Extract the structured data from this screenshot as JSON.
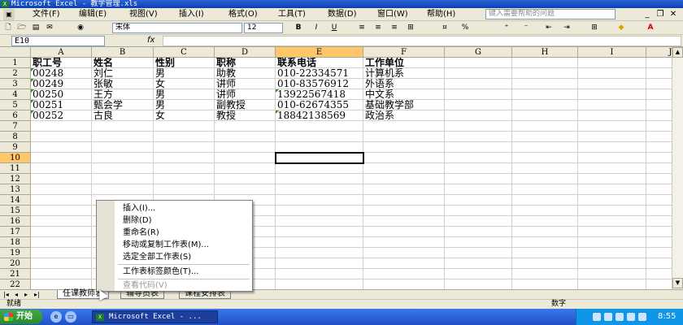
{
  "window": {
    "title": "Microsoft Excel - 教学管理.xls",
    "icon": "excel-icon"
  },
  "menu": {
    "items": [
      "文件(F)",
      "编辑(E)",
      "视图(V)",
      "插入(I)",
      "格式(O)",
      "工具(T)",
      "数据(D)",
      "窗口(W)",
      "帮助(H)"
    ],
    "help_placeholder": "键入需要帮助的问题",
    "close_label": "✕",
    "minimize_label": "_",
    "restore_label": "❐"
  },
  "toolbar": {
    "font_name": "宋体",
    "font_size": "12",
    "bold_label": "B",
    "italic_label": "I",
    "underline_label": "U",
    "percent_label": "%"
  },
  "formula_bar": {
    "name_box": "E10",
    "fx_label": "fx",
    "formula": ""
  },
  "sheet": {
    "columns": [
      "A",
      "B",
      "C",
      "D",
      "E",
      "F",
      "G",
      "H",
      "I",
      "J"
    ],
    "rows": [
      "1",
      "2",
      "3",
      "4",
      "5",
      "6",
      "7",
      "8",
      "9",
      "10",
      "11",
      "12",
      "13",
      "14",
      "15",
      "16",
      "17",
      "18",
      "19",
      "20",
      "21",
      "22"
    ],
    "selected_column": "E",
    "selected_row": "10",
    "data": [
      [
        "职工号",
        "姓名",
        "性别",
        "职称",
        "联系电话",
        "工作单位"
      ],
      [
        "00248",
        "刘仁",
        "男",
        "助教",
        "010-22334571",
        "计算机系"
      ],
      [
        "00249",
        "张敏",
        "女",
        "讲师",
        "010-83576912",
        "外语系"
      ],
      [
        "00250",
        "王方",
        "男",
        "讲师",
        "13922567418",
        "中文系"
      ],
      [
        "00251",
        "甄会学",
        "男",
        "副教授",
        "010-62674355",
        "基础教学部"
      ],
      [
        "00252",
        "古良",
        "女",
        "教授",
        "18842138569",
        "政治系"
      ]
    ]
  },
  "sheet_tabs": [
    "任课教师表",
    "辅导员表",
    "课程安排表"
  ],
  "tab_nav": [
    "|◂",
    "◂",
    "▸",
    "▸|"
  ],
  "context_menu": {
    "items": [
      {
        "label": "插入(I)...",
        "disabled": false
      },
      {
        "label": "删除(D)",
        "disabled": false
      },
      {
        "label": "重命名(R)",
        "disabled": false
      },
      {
        "label": "移动或复制工作表(M)...",
        "disabled": false
      },
      {
        "label": "选定全部工作表(S)",
        "disabled": false
      },
      {
        "label": "工作表标签颜色(T)...",
        "disabled": false
      },
      {
        "label": "查看代码(V)",
        "disabled": true
      }
    ]
  },
  "status_bar": {
    "left": "就绪",
    "right": "数字"
  },
  "taskbar": {
    "start_label": "开始",
    "task_label": "Microsoft Excel - ...",
    "clock": "8:55"
  }
}
